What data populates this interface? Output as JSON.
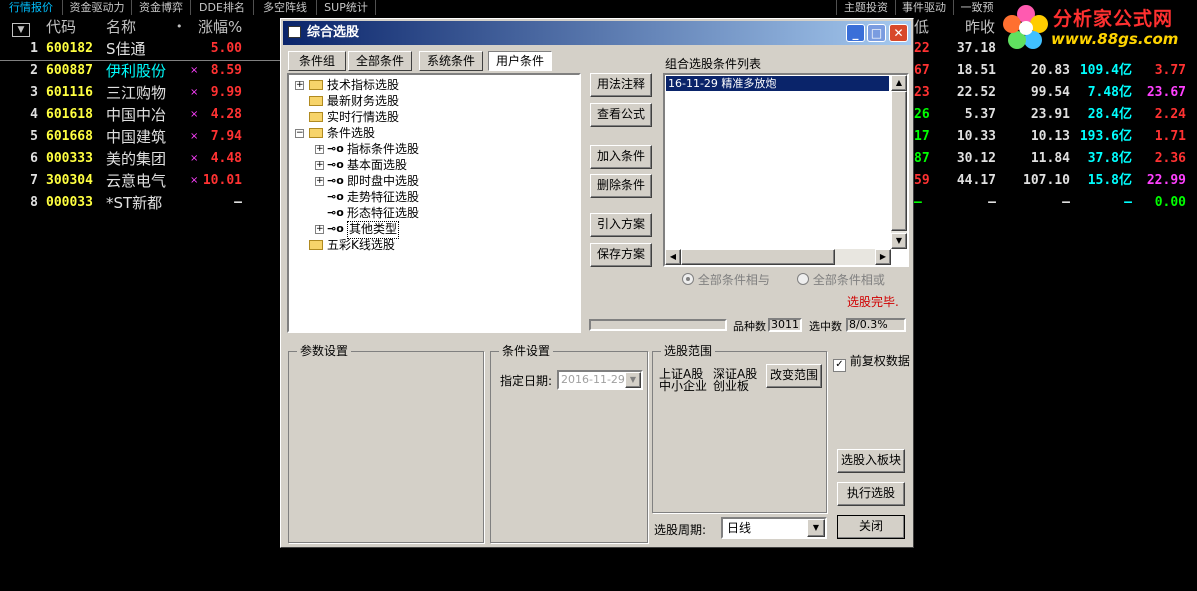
{
  "top_tabs": [
    {
      "label": "行情报价",
      "active": true
    },
    {
      "label": "资金驱动力",
      "active": false
    },
    {
      "label": "资金博弈",
      "active": false
    },
    {
      "label": "DDE排名",
      "active": false
    },
    {
      "label": "多空阵线",
      "active": false
    },
    {
      "label": "SUP统计",
      "active": false
    }
  ],
  "right_tabs": [
    {
      "label": "主题投资"
    },
    {
      "label": "事件驱动"
    },
    {
      "label": "一致预"
    }
  ],
  "logo": {
    "title": "分析家公式网",
    "url": "www.88gs.com"
  },
  "table": {
    "headers": {
      "code": "代码",
      "name": "名称",
      "dot": "•",
      "change": "涨幅%",
      "low": "低",
      "prev_close": "昨收"
    },
    "rows": [
      {
        "idx": "1",
        "code": "600182",
        "name": "S佳通",
        "mark": "",
        "change": "5.00",
        "c1": "22",
        "prev": "37.18",
        "p2": "",
        "amt": "",
        "last": ""
      },
      {
        "idx": "2",
        "code": "600887",
        "name": "伊利股份",
        "mark": "×",
        "change": "8.59",
        "c1": "67",
        "prev": "18.51",
        "p2": "20.83",
        "amt": "109.4亿",
        "last": "3.77"
      },
      {
        "idx": "3",
        "code": "601116",
        "name": "三江购物",
        "mark": "×",
        "change": "9.99",
        "c1": "23",
        "prev": "22.52",
        "p2": "99.54",
        "amt": "7.48亿",
        "last": "23.67"
      },
      {
        "idx": "4",
        "code": "601618",
        "name": "中国中冶",
        "mark": "×",
        "change": "4.28",
        "c1": "26",
        "prev": "5.37",
        "p2": "23.91",
        "amt": "28.4亿",
        "last": "2.24"
      },
      {
        "idx": "5",
        "code": "601668",
        "name": "中国建筑",
        "mark": "×",
        "change": "7.94",
        "c1": "17",
        "prev": "10.33",
        "p2": "10.13",
        "amt": "193.6亿",
        "last": "1.71"
      },
      {
        "idx": "6",
        "code": "000333",
        "name": "美的集团",
        "mark": "×",
        "change": "4.48",
        "c1": "87",
        "prev": "30.12",
        "p2": "11.84",
        "amt": "37.8亿",
        "last": "2.36"
      },
      {
        "idx": "7",
        "code": "300304",
        "name": "云意电气",
        "mark": "×",
        "change": "10.01",
        "c1": "59",
        "prev": "44.17",
        "p2": "107.10",
        "amt": "15.8亿",
        "last": "22.99"
      },
      {
        "idx": "8",
        "code": "000033",
        "name": "*ST新都",
        "mark": "",
        "change": "—",
        "c1": "—",
        "prev": "—",
        "p2": "—",
        "amt": "—",
        "last": "0.00"
      }
    ]
  },
  "dialog": {
    "title": "综合选股",
    "tabs": [
      "条件组",
      "全部条件",
      "系统条件",
      "用户条件"
    ],
    "tree": [
      {
        "label": "技术指标选股",
        "level": 0,
        "expander": "+",
        "icon": "folder"
      },
      {
        "label": "最新财务选股",
        "level": 0,
        "expander": "",
        "icon": "folder"
      },
      {
        "label": "实时行情选股",
        "level": 0,
        "expander": "",
        "icon": "folder"
      },
      {
        "label": "条件选股",
        "level": 0,
        "expander": "−",
        "icon": "folder"
      },
      {
        "label": "指标条件选股",
        "level": 1,
        "expander": "+",
        "icon": "key"
      },
      {
        "label": "基本面选股",
        "level": 1,
        "expander": "+",
        "icon": "key"
      },
      {
        "label": "即时盘中选股",
        "level": 1,
        "expander": "+",
        "icon": "key"
      },
      {
        "label": "走势特征选股",
        "level": 1,
        "expander": "",
        "icon": "key"
      },
      {
        "label": "形态特征选股",
        "level": 1,
        "expander": "",
        "icon": "key"
      },
      {
        "label": "其他类型",
        "level": 1,
        "expander": "+",
        "icon": "key"
      },
      {
        "label": "五彩K线选股",
        "level": 0,
        "expander": "",
        "icon": "folder"
      }
    ],
    "buttons": {
      "usage": "用法注释",
      "view_formula": "查看公式",
      "add_condition": "加入条件",
      "delete_condition": "删除条件",
      "import_plan": "引入方案",
      "save_plan": "保存方案",
      "change_range": "改变范围",
      "to_block": "选股入板块",
      "execute": "执行选股",
      "close": "关闭"
    },
    "cond_list_title": "组合选股条件列表",
    "cond_list_items": [
      "16-11-29 精准多放炮"
    ],
    "radio_and": "全部条件相与",
    "radio_or": "全部条件相或",
    "status": "选股完毕.",
    "count_label": "品种数",
    "count_value": "3011",
    "selected_label": "选中数",
    "selected_value": "8/0.3%",
    "param_group": "参数设置",
    "cond_group": "条件设置",
    "date_label": "指定日期:",
    "date_value": "2016-11-29",
    "range_group": "选股范围",
    "range_items": [
      "上证A股",
      "深证A股",
      "中小企业",
      "创业板"
    ],
    "fq_label": "前复权数据",
    "period_label": "选股周期:",
    "period_value": "日线"
  },
  "colors": {
    "up": "#ff3232",
    "cyan": "#00ffff",
    "yellow": "#ffff40",
    "green": "#00ff00",
    "magenta": "#ff40ff",
    "white": "#e0e0e0"
  }
}
